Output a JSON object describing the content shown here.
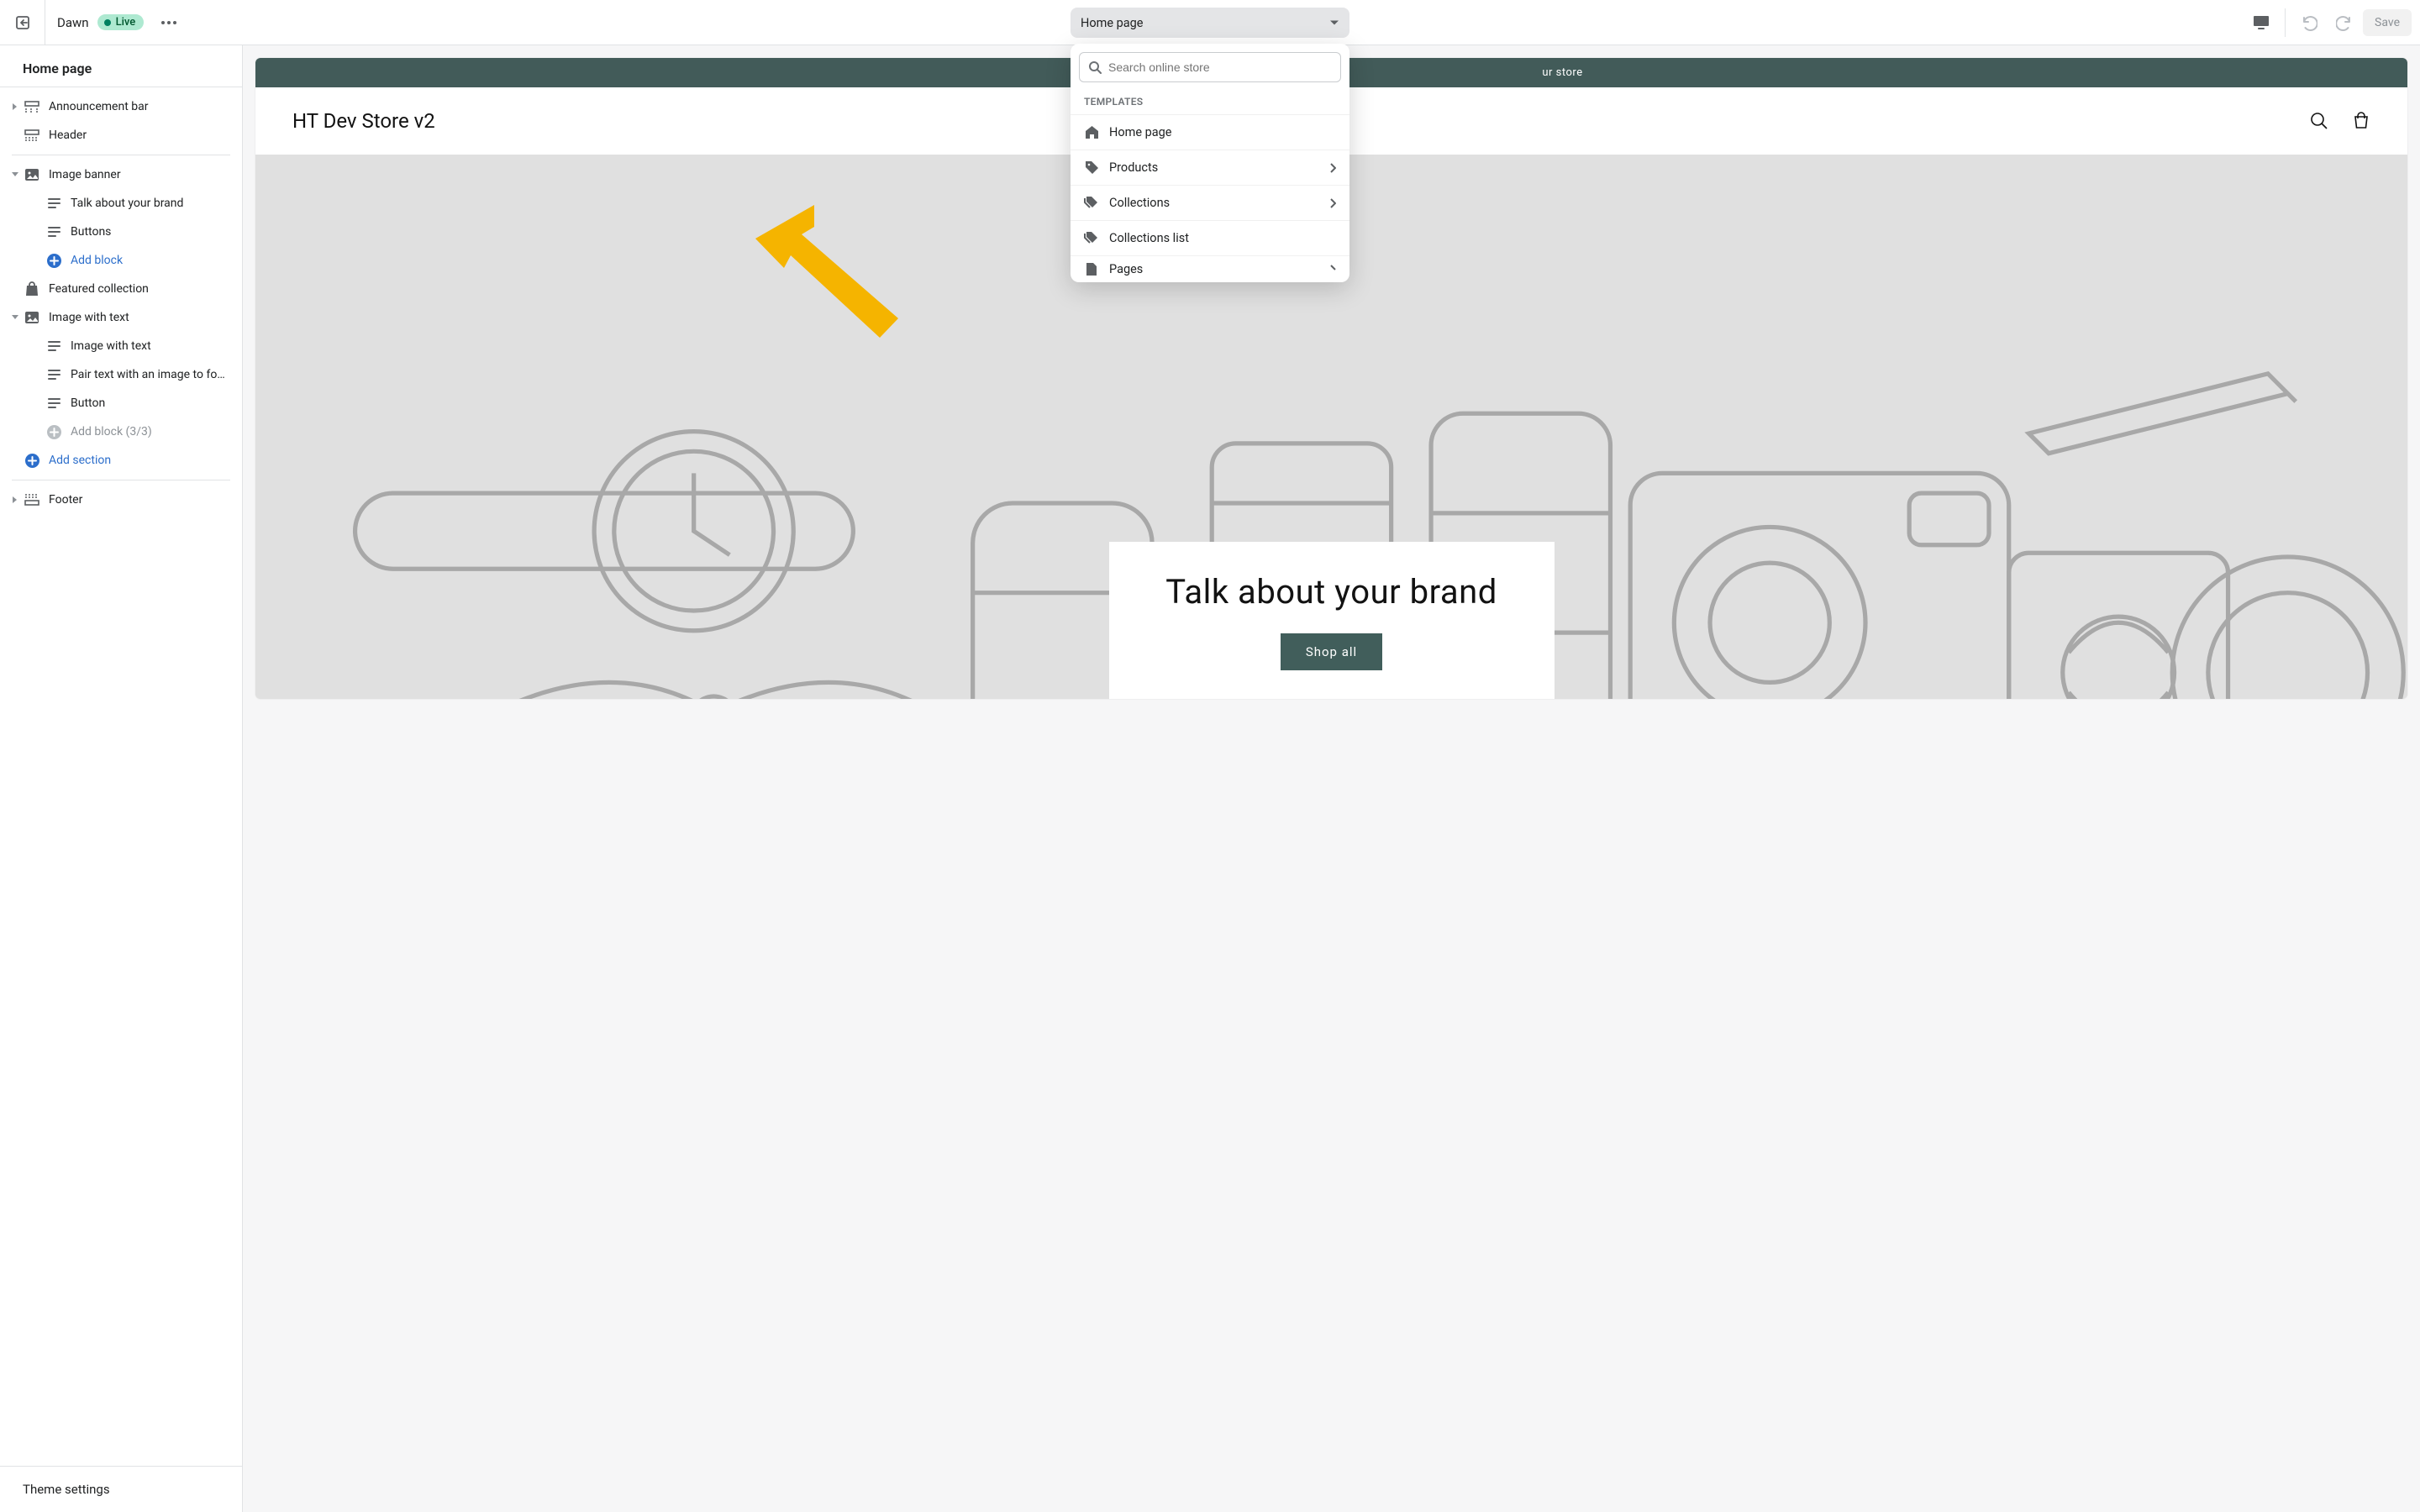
{
  "topbar": {
    "theme_name": "Dawn",
    "badge_label": "Live",
    "page_selector_label": "Home page",
    "save_label": "Save"
  },
  "sidebar": {
    "title": "Home page",
    "footer_label": "Theme settings",
    "sections": {
      "announcement_bar": "Announcement bar",
      "header": "Header",
      "image_banner": "Image banner",
      "talk_brand": "Talk about your brand",
      "buttons": "Buttons",
      "add_block": "Add block",
      "featured_collection": "Featured collection",
      "image_with_text_section": "Image with text",
      "image_with_text_child": "Image with text",
      "pair_text": "Pair text with an image to focu...",
      "button": "Button",
      "add_block_3_3": "Add block (3/3)",
      "add_section": "Add section",
      "footer": "Footer"
    }
  },
  "popover": {
    "search_placeholder": "Search online store",
    "header_label": "TEMPLATES",
    "items": {
      "home": "Home page",
      "products": "Products",
      "collections": "Collections",
      "collections_list": "Collections list",
      "pages": "Pages"
    }
  },
  "preview": {
    "announcement_text": "ur store",
    "store_name": "HT Dev Store v2",
    "banner_heading": "Talk about your brand",
    "banner_button": "Shop all"
  },
  "colors": {
    "accent_link": "#2c6ecb",
    "badge_bg": "#aee9d1",
    "announce_bg": "#425b59",
    "arrow": "#f5b400"
  }
}
